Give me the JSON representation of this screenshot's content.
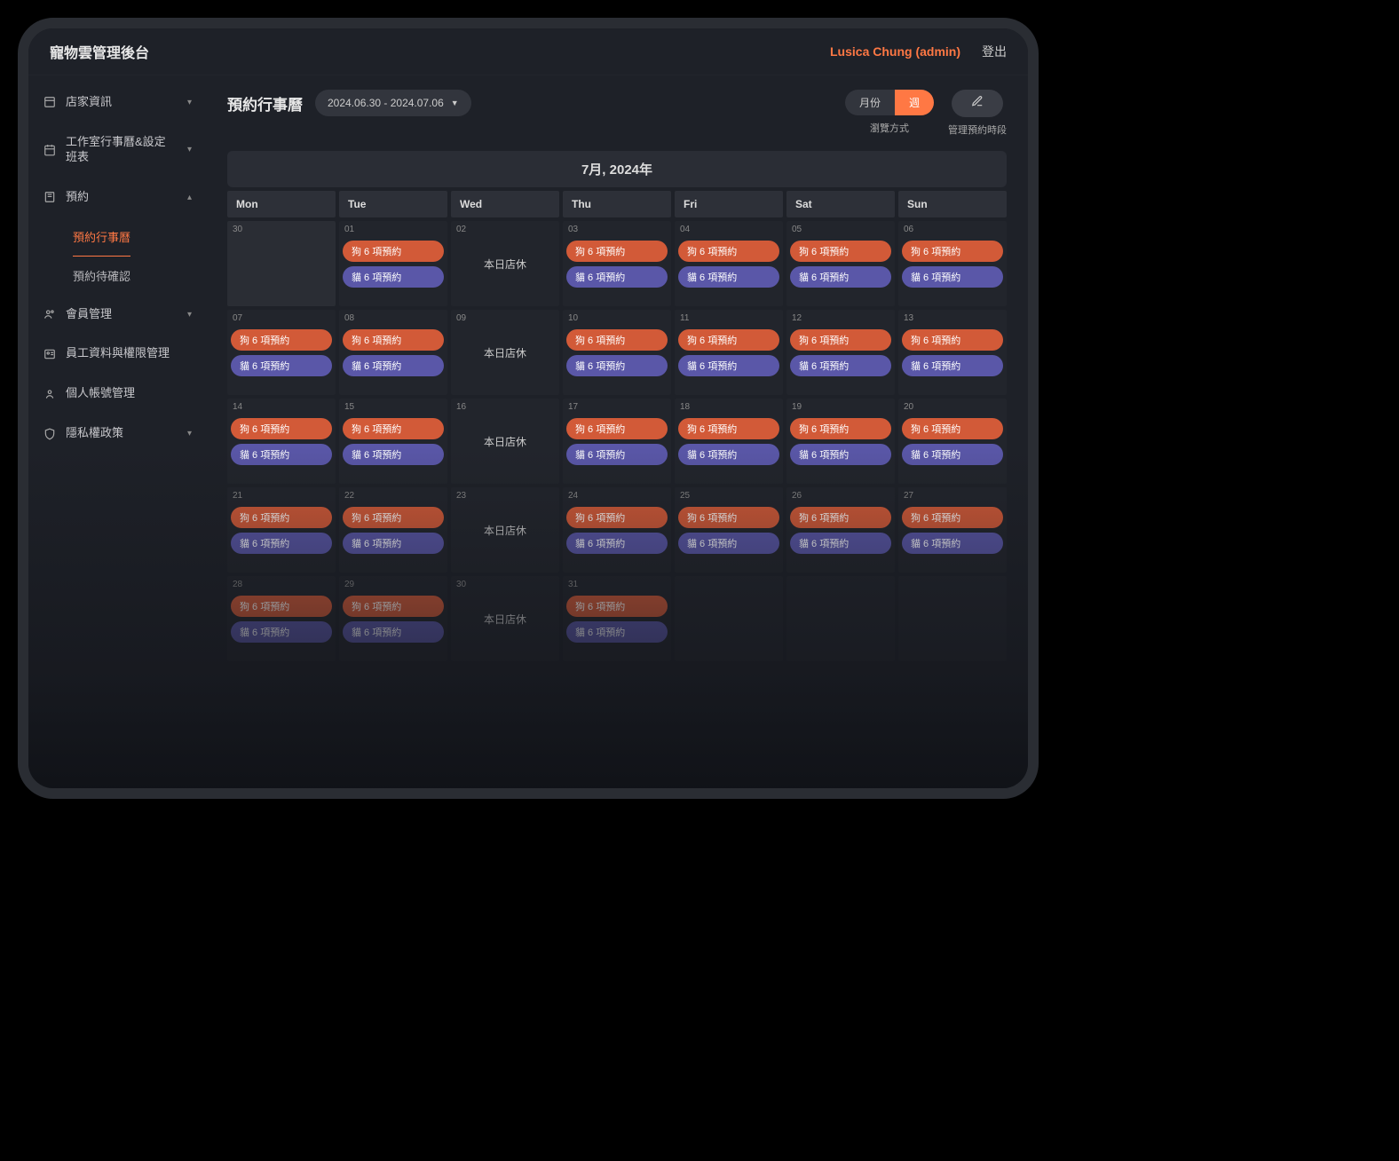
{
  "header": {
    "app_title": "寵物雲管理後台",
    "user_label": "Lusica Chung (admin)",
    "logout": "登出"
  },
  "sidebar": {
    "items": [
      {
        "icon": "store",
        "label": "店家資訊",
        "expand": true
      },
      {
        "icon": "calendar",
        "label": "工作室行事曆&設定班表",
        "expand": true
      },
      {
        "icon": "book",
        "label": "預約",
        "expand": true,
        "open": true,
        "children": [
          {
            "label": "預約行事曆",
            "active": true
          },
          {
            "label": "預約待確認"
          }
        ]
      },
      {
        "icon": "people",
        "label": "會員管理",
        "expand": true
      },
      {
        "icon": "staff",
        "label": "員工資料與權限管理"
      },
      {
        "icon": "person",
        "label": "個人帳號管理"
      },
      {
        "icon": "shield",
        "label": "隱私權政策",
        "expand": true
      }
    ]
  },
  "toolbar": {
    "page_title": "預約行事曆",
    "date_range": "2024.06.30 - 2024.07.06",
    "view_month": "月份",
    "view_week": "週",
    "view_caption": "瀏覽方式",
    "manage_caption": "管理預約時段"
  },
  "calendar": {
    "title": "7月, 2024年",
    "weekdays": [
      "Mon",
      "Tue",
      "Wed",
      "Thu",
      "Fri",
      "Sat",
      "Sun"
    ],
    "dog_label": "狗 6 項預約",
    "cat_label": "貓 6 項預約",
    "closed_label": "本日店休",
    "weeks": [
      [
        {
          "num": "30",
          "dim": true,
          "type": "empty"
        },
        {
          "num": "01",
          "type": "events"
        },
        {
          "num": "02",
          "type": "closed"
        },
        {
          "num": "03",
          "type": "events"
        },
        {
          "num": "04",
          "type": "events"
        },
        {
          "num": "05",
          "type": "events"
        },
        {
          "num": "06",
          "type": "events"
        }
      ],
      [
        {
          "num": "07",
          "type": "events"
        },
        {
          "num": "08",
          "type": "events"
        },
        {
          "num": "09",
          "type": "closed"
        },
        {
          "num": "10",
          "type": "events"
        },
        {
          "num": "11",
          "type": "events"
        },
        {
          "num": "12",
          "type": "events"
        },
        {
          "num": "13",
          "type": "events"
        }
      ],
      [
        {
          "num": "14",
          "type": "events"
        },
        {
          "num": "15",
          "type": "events"
        },
        {
          "num": "16",
          "type": "closed"
        },
        {
          "num": "17",
          "type": "events"
        },
        {
          "num": "18",
          "type": "events"
        },
        {
          "num": "19",
          "type": "events"
        },
        {
          "num": "20",
          "type": "events"
        }
      ],
      [
        {
          "num": "21",
          "type": "events"
        },
        {
          "num": "22",
          "type": "events"
        },
        {
          "num": "23",
          "type": "closed"
        },
        {
          "num": "24",
          "type": "events"
        },
        {
          "num": "25",
          "type": "events"
        },
        {
          "num": "26",
          "type": "events"
        },
        {
          "num": "27",
          "type": "events"
        }
      ],
      [
        {
          "num": "28",
          "type": "events"
        },
        {
          "num": "29",
          "type": "events"
        },
        {
          "num": "30",
          "type": "closed"
        },
        {
          "num": "31",
          "type": "events"
        },
        {
          "num": "",
          "type": "empty"
        },
        {
          "num": "",
          "type": "empty"
        },
        {
          "num": "",
          "type": "empty"
        }
      ]
    ]
  }
}
